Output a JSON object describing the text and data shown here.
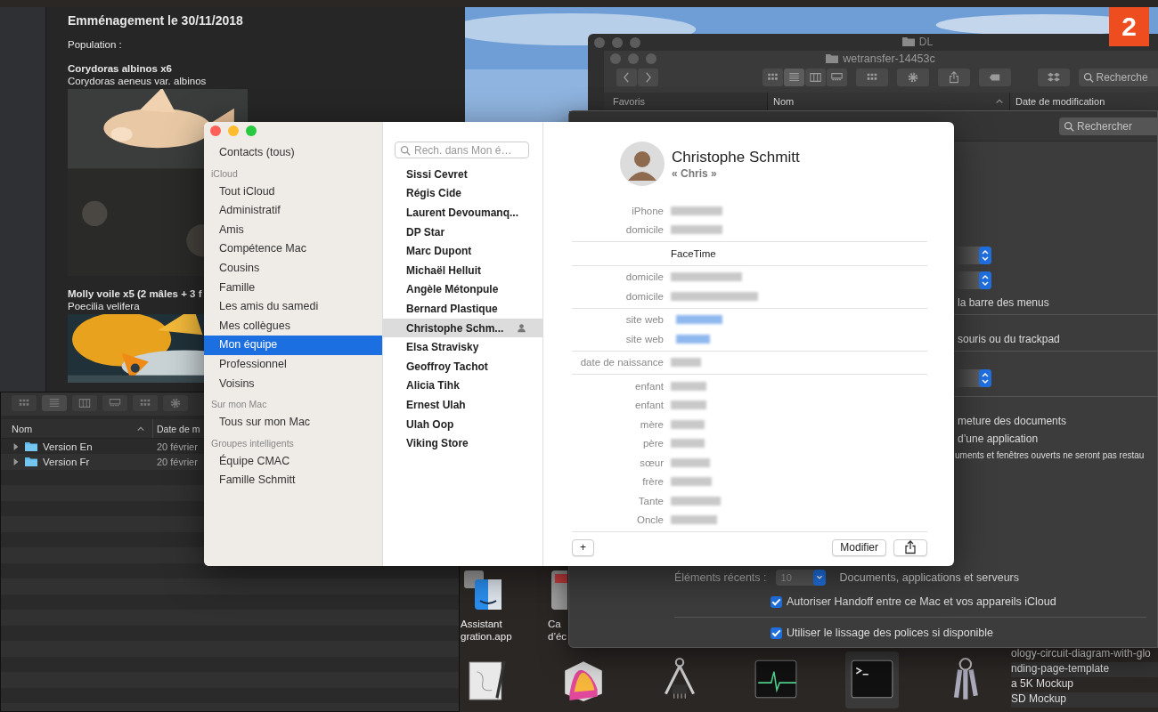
{
  "notes": {
    "heading": "Emménagement le 30/11/2018",
    "label": "Population :",
    "entries": [
      {
        "name": "Corydoras albinos x6",
        "latin": "Corydoras aeneus var. albinos"
      },
      {
        "name": "Molly voile x5 (2 mâles + 3 f",
        "latin": "Poecilia velifera"
      }
    ]
  },
  "badge": "2",
  "finder_back": {
    "title": "DL"
  },
  "finder_front": {
    "title": "wetransfer-14453c",
    "search_placeholder": "Recherche",
    "sidebar_heading": "Favoris",
    "columns": [
      "Nom",
      "Date de modification"
    ]
  },
  "preferences": {
    "search_placeholder": "Rechercher",
    "texts": [
      {
        "kind": "dropdown"
      },
      {
        "kind": "dropdown"
      },
      {
        "kind": "text",
        "text": "la barre des menus"
      },
      {
        "kind": "divider"
      },
      {
        "kind": "text",
        "text": "souris ou du trackpad"
      },
      {
        "kind": "divider"
      },
      {
        "kind": "dropdown"
      },
      {
        "kind": "divider"
      },
      {
        "kind": "text",
        "text": "meture des documents"
      },
      {
        "kind": "text",
        "text": "d’une application"
      },
      {
        "kind": "note",
        "text": "uments et fenêtres ouverts ne seront pas restau"
      }
    ],
    "recent": {
      "label": "Éléments récents :",
      "value": "10",
      "suffix": "Documents, applications et serveurs"
    },
    "checkboxes": [
      {
        "label": "Autoriser Handoff entre ce Mac et vos appareils iCloud",
        "checked": true
      },
      {
        "label": "Utiliser le lissage des polices si disponible",
        "checked": true
      }
    ]
  },
  "finder_bottom": {
    "columns": [
      "Nom",
      "Date de m"
    ],
    "rows": [
      {
        "name": "Version En",
        "date": "20 février"
      },
      {
        "name": "Version Fr",
        "date": "20 février"
      }
    ]
  },
  "desktop_icons": [
    {
      "lines": [
        "Assistant",
        "gration.app"
      ]
    },
    {
      "lines": [
        "Ca",
        "d’éc"
      ]
    }
  ],
  "desktop_files": [
    "ology-circuit-diagram-with-glo",
    "nding-page-template",
    "a 5K Mockup",
    "SD Mockup"
  ],
  "contacts": {
    "sidebar": [
      {
        "kind": "item",
        "label": "Contacts (tous)",
        "selected": false
      },
      {
        "kind": "header",
        "label": "iCloud"
      },
      {
        "kind": "item",
        "label": "Tout iCloud",
        "selected": false
      },
      {
        "kind": "item",
        "label": "Administratif",
        "selected": false
      },
      {
        "kind": "item",
        "label": "Amis",
        "selected": false
      },
      {
        "kind": "item",
        "label": "Compétence Mac",
        "selected": false
      },
      {
        "kind": "item",
        "label": "Cousins",
        "selected": false
      },
      {
        "kind": "item",
        "label": "Famille",
        "selected": false
      },
      {
        "kind": "item",
        "label": "Les amis du samedi",
        "selected": false
      },
      {
        "kind": "item",
        "label": "Mes collègues",
        "selected": false
      },
      {
        "kind": "item",
        "label": "Mon équipe",
        "selected": true
      },
      {
        "kind": "item",
        "label": "Professionnel",
        "selected": false
      },
      {
        "kind": "item",
        "label": "Voisins",
        "selected": false
      },
      {
        "kind": "header",
        "label": "Sur mon Mac"
      },
      {
        "kind": "item",
        "label": "Tous sur mon Mac",
        "selected": false
      },
      {
        "kind": "header",
        "label": "Groupes intelligents"
      },
      {
        "kind": "item",
        "label": "Équipe CMAC",
        "selected": false
      },
      {
        "kind": "item",
        "label": "Famille Schmitt",
        "selected": false
      }
    ],
    "search_placeholder": "Rech. dans Mon é…",
    "people": [
      {
        "name": "Sissi Cevret",
        "selected": false
      },
      {
        "name": "Régis Cide",
        "selected": false
      },
      {
        "name": "Laurent Devoumanq...",
        "selected": false
      },
      {
        "name": "DP Star",
        "selected": false
      },
      {
        "name": "Marc Dupont",
        "selected": false
      },
      {
        "name": "Michaël Helluit",
        "selected": false
      },
      {
        "name": "Angèle Métonpule",
        "selected": false
      },
      {
        "name": "Bernard Plastique",
        "selected": false
      },
      {
        "name": "Christophe Schm...",
        "selected": true
      },
      {
        "name": "Elsa Stravisky",
        "selected": false
      },
      {
        "name": "Geoffroy Tachot",
        "selected": false
      },
      {
        "name": "Alicia Tihk",
        "selected": false
      },
      {
        "name": "Ernest Ulah",
        "selected": false
      },
      {
        "name": "Ulah Oop",
        "selected": false
      },
      {
        "name": "Viking Store",
        "selected": false
      }
    ],
    "card": {
      "name": "Christophe Schmitt",
      "nickname": "« Chris »",
      "groups": [
        [
          {
            "label": "iPhone",
            "kind": "blurred"
          },
          {
            "label": "domicile",
            "kind": "blurred"
          }
        ],
        [
          {
            "kind": "facetime",
            "text": "FaceTime"
          }
        ],
        [
          {
            "label": "domicile",
            "kind": "blurred"
          },
          {
            "label": "domicile",
            "kind": "blurred"
          }
        ],
        [
          {
            "label": "site web",
            "kind": "link"
          },
          {
            "label": "site web",
            "kind": "link"
          }
        ],
        [
          {
            "label": "date de naissance",
            "kind": "blurred"
          }
        ],
        [
          {
            "label": "enfant",
            "kind": "blurred"
          },
          {
            "label": "enfant",
            "kind": "blurred"
          },
          {
            "label": "mère",
            "kind": "blurred"
          },
          {
            "label": "père",
            "kind": "blurred"
          },
          {
            "label": "sœur",
            "kind": "blurred"
          },
          {
            "label": "frère",
            "kind": "blurred"
          },
          {
            "label": "Tante",
            "kind": "blurred"
          },
          {
            "label": "Oncle",
            "kind": "blurred"
          }
        ]
      ],
      "add_button": "+",
      "edit_button": "Modifier"
    }
  }
}
